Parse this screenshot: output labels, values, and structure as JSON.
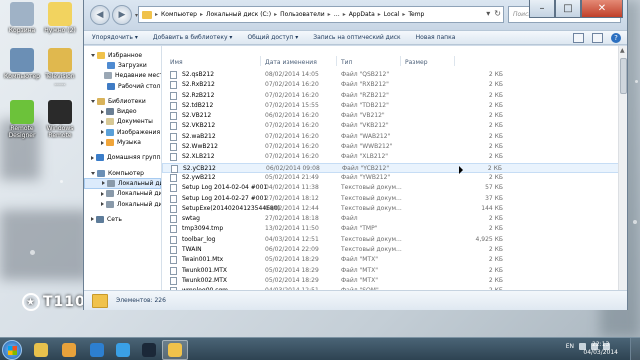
{
  "desktop": {
    "icons": [
      {
        "label": "Корзина",
        "color": "#9fb2c6"
      },
      {
        "label": "Нужно (2)",
        "color": "#f2d35f"
      },
      {
        "label": "Компьютер",
        "color": "#6b8fb5"
      },
      {
        "label": "Television ......",
        "color": "#e0b84e"
      },
      {
        "label": "Remote Designer",
        "color": "#6cc23a"
      },
      {
        "label": "Windows Remote",
        "color": "#2a2a2a"
      }
    ],
    "brand_logo": "T110E4"
  },
  "window": {
    "address": {
      "crumbs": [
        "Компьютер",
        "Локальный диск (C:)",
        "Пользователи",
        "…",
        "AppData",
        "Local",
        "Temp"
      ]
    },
    "search": {
      "placeholder": "Поиск: Temp"
    },
    "toolbar": {
      "organize": "Упорядочить ▾",
      "add_to_library": "Добавить в библиотеку ▾",
      "share": "Общий доступ ▾",
      "burn": "Запись на оптический диск",
      "new_folder": "Новая папка"
    },
    "nav": [
      {
        "label": "Избранное",
        "level": 0,
        "tri": "open",
        "icon_color": "#f0c24b",
        "gap_before": false
      },
      {
        "label": "Загрузки",
        "level": 1,
        "tri": "",
        "icon_color": "#4f8bd1",
        "gap_before": false
      },
      {
        "label": "Недавние места",
        "level": 1,
        "tri": "",
        "icon_color": "#9aa7b4",
        "gap_before": false
      },
      {
        "label": "Рабочий стол",
        "level": 1,
        "tri": "",
        "icon_color": "#3f7bc4",
        "gap_before": false
      },
      {
        "label": "Библиотеки",
        "level": 0,
        "tri": "open",
        "icon_color": "#d9b35a",
        "gap_before": true
      },
      {
        "label": "Видео",
        "level": 1,
        "tri": "closed",
        "icon_color": "#6a7f94",
        "gap_before": false
      },
      {
        "label": "Документы",
        "level": 1,
        "tri": "closed",
        "icon_color": "#d7c894",
        "gap_before": false
      },
      {
        "label": "Изображения",
        "level": 1,
        "tri": "closed",
        "icon_color": "#5aa0d8",
        "gap_before": false
      },
      {
        "label": "Музыка",
        "level": 1,
        "tri": "closed",
        "icon_color": "#f0a53a",
        "gap_before": false
      },
      {
        "label": "Домашняя группа",
        "level": 0,
        "tri": "closed",
        "icon_color": "#3b7dc9",
        "gap_before": true
      },
      {
        "label": "Компьютер",
        "level": 0,
        "tri": "open",
        "icon_color": "#6b8fb5",
        "gap_before": true
      },
      {
        "label": "Локальный диск (C",
        "level": 1,
        "tri": "closed",
        "icon_color": "#8a9aaa",
        "gap_before": false,
        "selected": true
      },
      {
        "label": "Локальный диск (D",
        "level": 1,
        "tri": "closed",
        "icon_color": "#8a9aaa",
        "gap_before": false
      },
      {
        "label": "Локальный диск (E",
        "level": 1,
        "tri": "closed",
        "icon_color": "#8a9aaa",
        "gap_before": false
      },
      {
        "label": "Сеть",
        "level": 0,
        "tri": "closed",
        "icon_color": "#5e7c9a",
        "gap_before": true
      }
    ],
    "columns": {
      "name": "Имя",
      "date": "Дата изменения",
      "type": "Тип",
      "size": "Размер"
    },
    "files": [
      {
        "name": "S2.qsB212",
        "date": "08/02/2014 14:05",
        "type": "Файл \"QSB212\"",
        "size": "2 КБ"
      },
      {
        "name": "S2.RxB212",
        "date": "07/02/2014 16:20",
        "type": "Файл \"RXB212\"",
        "size": "2 КБ"
      },
      {
        "name": "S2.RzB212",
        "date": "07/02/2014 16:20",
        "type": "Файл \"RZB212\"",
        "size": "2 КБ"
      },
      {
        "name": "S2.tdB212",
        "date": "07/02/2014 15:55",
        "type": "Файл \"TDB212\"",
        "size": "2 КБ"
      },
      {
        "name": "S2.VB212",
        "date": "06/02/2014 16:20",
        "type": "Файл \"VB212\"",
        "size": "2 КБ"
      },
      {
        "name": "S2.VKB212",
        "date": "07/02/2014 16:20",
        "type": "Файл \"VKB212\"",
        "size": "2 КБ"
      },
      {
        "name": "S2.waB212",
        "date": "07/02/2014 16:20",
        "type": "Файл \"WAB212\"",
        "size": "2 КБ"
      },
      {
        "name": "S2.WwB212",
        "date": "07/02/2014 16:20",
        "type": "Файл \"WWB212\"",
        "size": "2 КБ"
      },
      {
        "name": "S2.XLB212",
        "date": "07/02/2014 16:20",
        "type": "Файл \"XLB212\"",
        "size": "2 КБ"
      },
      {
        "name": "S2.yCB212",
        "date": "06/02/2014 09:08",
        "type": "Файл \"YCB212\"",
        "size": "2 КБ"
      },
      {
        "name": "S2.ywB212",
        "date": "05/02/2014 21:49",
        "type": "Файл \"YWB212\"",
        "size": "2 КБ"
      },
      {
        "name": "Setup Log 2014-02-04 #001",
        "date": "04/02/2014 11:38",
        "type": "Текстовый докум...",
        "size": "57 КБ"
      },
      {
        "name": "Setup Log 2014-02-27 #001",
        "date": "27/02/2014 18:12",
        "type": "Текстовый докум...",
        "size": "37 КБ"
      },
      {
        "name": "SetupExe(20140204123544E80)",
        "date": "04/02/2014 12:44",
        "type": "Текстовый докум...",
        "size": "144 КБ"
      },
      {
        "name": "swtag",
        "date": "27/02/2014 18:18",
        "type": "Файл",
        "size": "2 КБ"
      },
      {
        "name": "tmp3094.tmp",
        "date": "13/02/2014 11:50",
        "type": "Файл \"TMP\"",
        "size": "2 КБ"
      },
      {
        "name": "toolbar_log",
        "date": "04/03/2014 12:51",
        "type": "Текстовый докум...",
        "size": "4,925 КБ"
      },
      {
        "name": "TWAIN",
        "date": "06/02/2014 22:09",
        "type": "Текстовый докум...",
        "size": "2 КБ"
      },
      {
        "name": "Twain001.Mtx",
        "date": "05/02/2014 18:29",
        "type": "Файл \"MTX\"",
        "size": "2 КБ"
      },
      {
        "name": "Twunk001.MTX",
        "date": "05/02/2014 18:29",
        "type": "Файл \"MTX\"",
        "size": "2 КБ"
      },
      {
        "name": "Twunk002.MTX",
        "date": "05/02/2014 18:29",
        "type": "Файл \"MTX\"",
        "size": "2 КБ"
      },
      {
        "name": "wmplog00.sqm",
        "date": "04/03/2014 12:51",
        "type": "Файл \"SQM\"",
        "size": "2 КБ"
      }
    ],
    "hover_row": 9,
    "status": {
      "count": "Элементов: 226"
    }
  },
  "taskbar": {
    "apps": [
      {
        "color": "#e8c14c"
      },
      {
        "color": "#e9a23b"
      },
      {
        "color": "#2d7fd0"
      },
      {
        "color": "#3aa0e6"
      },
      {
        "color": "#1b2838"
      },
      {
        "color": "#f0c24b"
      }
    ],
    "lang": "EN",
    "time": "22:13",
    "date": "04/03/2014"
  }
}
